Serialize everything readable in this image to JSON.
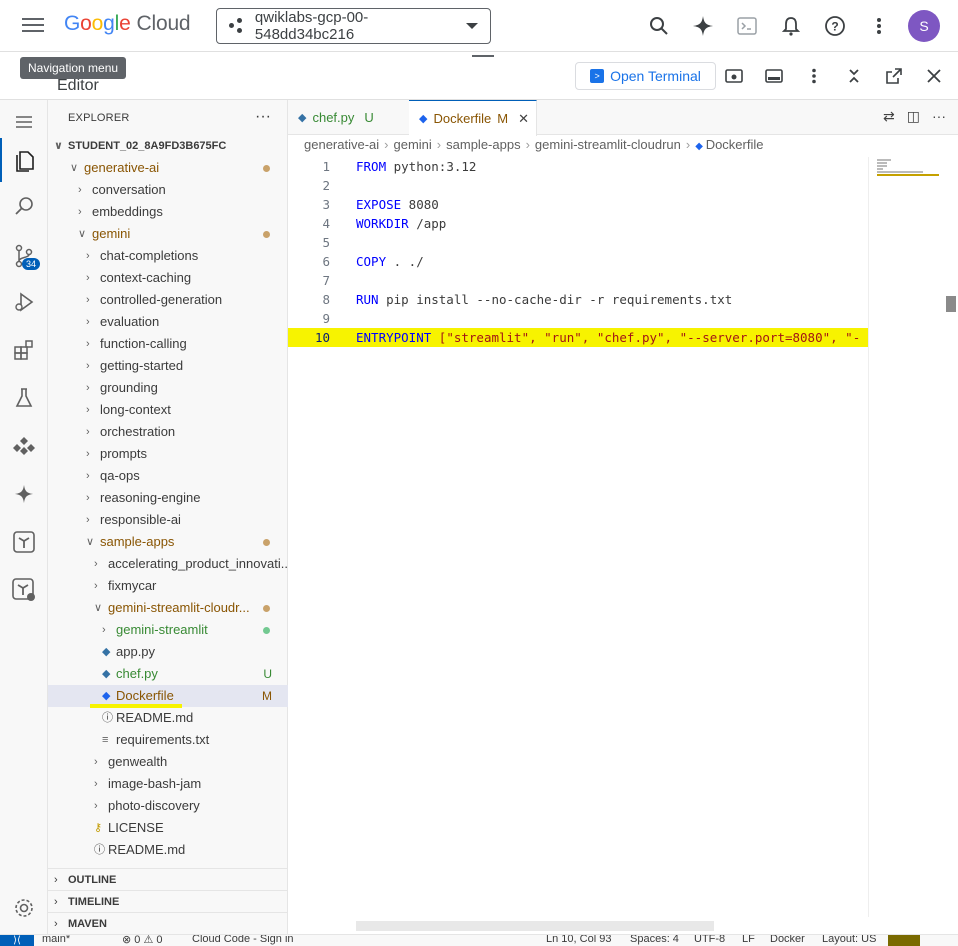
{
  "cloudbar": {
    "logo_google": "Google",
    "logo_cloud": "Cloud",
    "project": "qwiklabs-gcp-00-548dd34bc216",
    "avatar_initial": "S",
    "icons": [
      "search-icon",
      "gemini-spark-icon",
      "cloud-shell-icon",
      "notifications-icon",
      "help-icon",
      "more-vert-icon"
    ]
  },
  "editor_header": {
    "tooltip": "Navigation menu",
    "title": "Editor",
    "open_terminal": "Open Terminal",
    "icons": [
      "web-preview-icon",
      "panel-icon",
      "more-vert-icon",
      "collapse-icon",
      "open-new-window-icon",
      "close-icon"
    ]
  },
  "activity_bar": {
    "items": [
      "explorer-icon",
      "search-icon",
      "source-control-icon",
      "run-debug-icon",
      "extensions-icon",
      "testing-icon",
      "cloud-code-icon",
      "gemini-icon",
      "terraform-icon",
      "terraform-cloud-icon",
      "settings-icon"
    ],
    "source_control_badge": "34"
  },
  "explorer": {
    "title": "EXPLORER",
    "root": "STUDENT_02_8A9FD3B675FC",
    "tree": [
      {
        "label": "generative-ai",
        "depth": 1,
        "kind": "folder-open",
        "status": "dot-mod"
      },
      {
        "label": "conversation",
        "depth": 2,
        "kind": "folder"
      },
      {
        "label": "embeddings",
        "depth": 2,
        "kind": "folder"
      },
      {
        "label": "gemini",
        "depth": 2,
        "kind": "folder-open",
        "status": "dot-mod"
      },
      {
        "label": "chat-completions",
        "depth": 3,
        "kind": "folder"
      },
      {
        "label": "context-caching",
        "depth": 3,
        "kind": "folder"
      },
      {
        "label": "controlled-generation",
        "depth": 3,
        "kind": "folder"
      },
      {
        "label": "evaluation",
        "depth": 3,
        "kind": "folder"
      },
      {
        "label": "function-calling",
        "depth": 3,
        "kind": "folder"
      },
      {
        "label": "getting-started",
        "depth": 3,
        "kind": "folder"
      },
      {
        "label": "grounding",
        "depth": 3,
        "kind": "folder"
      },
      {
        "label": "long-context",
        "depth": 3,
        "kind": "folder"
      },
      {
        "label": "orchestration",
        "depth": 3,
        "kind": "folder"
      },
      {
        "label": "prompts",
        "depth": 3,
        "kind": "folder"
      },
      {
        "label": "qa-ops",
        "depth": 3,
        "kind": "folder"
      },
      {
        "label": "reasoning-engine",
        "depth": 3,
        "kind": "folder"
      },
      {
        "label": "responsible-ai",
        "depth": 3,
        "kind": "folder"
      },
      {
        "label": "sample-apps",
        "depth": 3,
        "kind": "folder-open",
        "status": "dot-mod"
      },
      {
        "label": "accelerating_product_innovati...",
        "depth": 4,
        "kind": "folder"
      },
      {
        "label": "fixmycar",
        "depth": 4,
        "kind": "folder"
      },
      {
        "label": "gemini-streamlit-cloudr...",
        "depth": 4,
        "kind": "folder-open",
        "status": "dot-mod"
      },
      {
        "label": "gemini-streamlit",
        "depth": 5,
        "kind": "folder",
        "status": "dot-untr"
      },
      {
        "label": "app.py",
        "depth": 5,
        "kind": "python"
      },
      {
        "label": "chef.py",
        "depth": 5,
        "kind": "python",
        "status": "U"
      },
      {
        "label": "Dockerfile",
        "depth": 5,
        "kind": "docker",
        "status": "M",
        "selected": true
      },
      {
        "label": "README.md",
        "depth": 5,
        "kind": "info"
      },
      {
        "label": "requirements.txt",
        "depth": 5,
        "kind": "text"
      },
      {
        "label": "genwealth",
        "depth": 4,
        "kind": "folder"
      },
      {
        "label": "image-bash-jam",
        "depth": 4,
        "kind": "folder"
      },
      {
        "label": "photo-discovery",
        "depth": 4,
        "kind": "folder"
      },
      {
        "label": "LICENSE",
        "depth": 4,
        "kind": "license"
      },
      {
        "label": "README.md",
        "depth": 4,
        "kind": "info"
      }
    ],
    "panels": [
      "OUTLINE",
      "TIMELINE",
      "MAVEN"
    ]
  },
  "tabs": [
    {
      "label": "chef.py",
      "status": "U"
    },
    {
      "label": "Dockerfile",
      "status": "M",
      "active": true
    }
  ],
  "breadcrumbs": [
    "generative-ai",
    "gemini",
    "sample-apps",
    "gemini-streamlit-cloudrun",
    "Dockerfile"
  ],
  "code": [
    {
      "n": "1",
      "kw": "FROM",
      "rest": " python:3.12"
    },
    {
      "n": "2",
      "kw": "",
      "rest": ""
    },
    {
      "n": "3",
      "kw": "EXPOSE",
      "rest": " 8080"
    },
    {
      "n": "4",
      "kw": "WORKDIR",
      "rest": " /app"
    },
    {
      "n": "5",
      "kw": "",
      "rest": ""
    },
    {
      "n": "6",
      "kw": "COPY",
      "rest": " . ./"
    },
    {
      "n": "7",
      "kw": "",
      "rest": ""
    },
    {
      "n": "8",
      "kw": "RUN",
      "rest": " pip install --no-cache-dir -r requirements.txt"
    },
    {
      "n": "9",
      "kw": "",
      "rest": ""
    },
    {
      "n": "10",
      "kw": "ENTRYPOINT",
      "rest": " [\"streamlit\", \"run\", \"chef.py\", \"--server.port=8080\", \"-",
      "highlight": true
    }
  ],
  "statusbar": {
    "branch": "main*",
    "problems": "⊗ 0 ⚠ 0",
    "cloud_code": "Cloud Code - Sign in",
    "position": "Ln 10, Col 93",
    "spaces": "Spaces: 4",
    "encoding": "UTF-8",
    "eol": "LF",
    "language": "Docker",
    "layout": "Layout: US"
  },
  "colors": {
    "accent": "#005fb8",
    "highlight": "#f7f300",
    "modified": "#895503",
    "untracked": "#388a34"
  }
}
